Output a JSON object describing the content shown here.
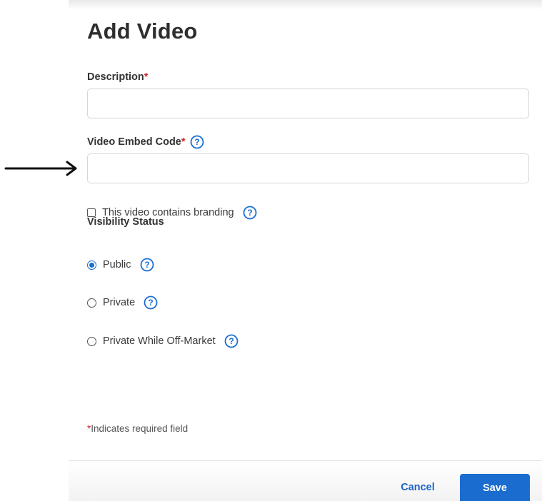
{
  "colors": {
    "accent": "#1a6ccf",
    "required": "#d0252e",
    "help_icon": "#1a6fd1"
  },
  "page": {
    "title": "Add Video"
  },
  "form": {
    "description": {
      "label": "Description",
      "required_mark": "*",
      "value": ""
    },
    "embed_code": {
      "label": "Video Embed Code",
      "required_mark": "*",
      "help_icon": "question-circle-icon",
      "value": ""
    },
    "branding": {
      "label": "This video contains branding",
      "checked": false,
      "help_icon": "question-circle-icon"
    },
    "visibility": {
      "label": "Visibility Status",
      "options": [
        {
          "label": "Public",
          "selected": true
        },
        {
          "label": "Private",
          "selected": false
        },
        {
          "label": "Private While Off-Market",
          "selected": false
        }
      ]
    },
    "required_note": {
      "mark": "*",
      "text": "Indicates required field"
    }
  },
  "annotation": {
    "arrow_icon": "arrow-right-icon"
  },
  "footer": {
    "cancel_label": "Cancel",
    "save_label": "Save"
  }
}
